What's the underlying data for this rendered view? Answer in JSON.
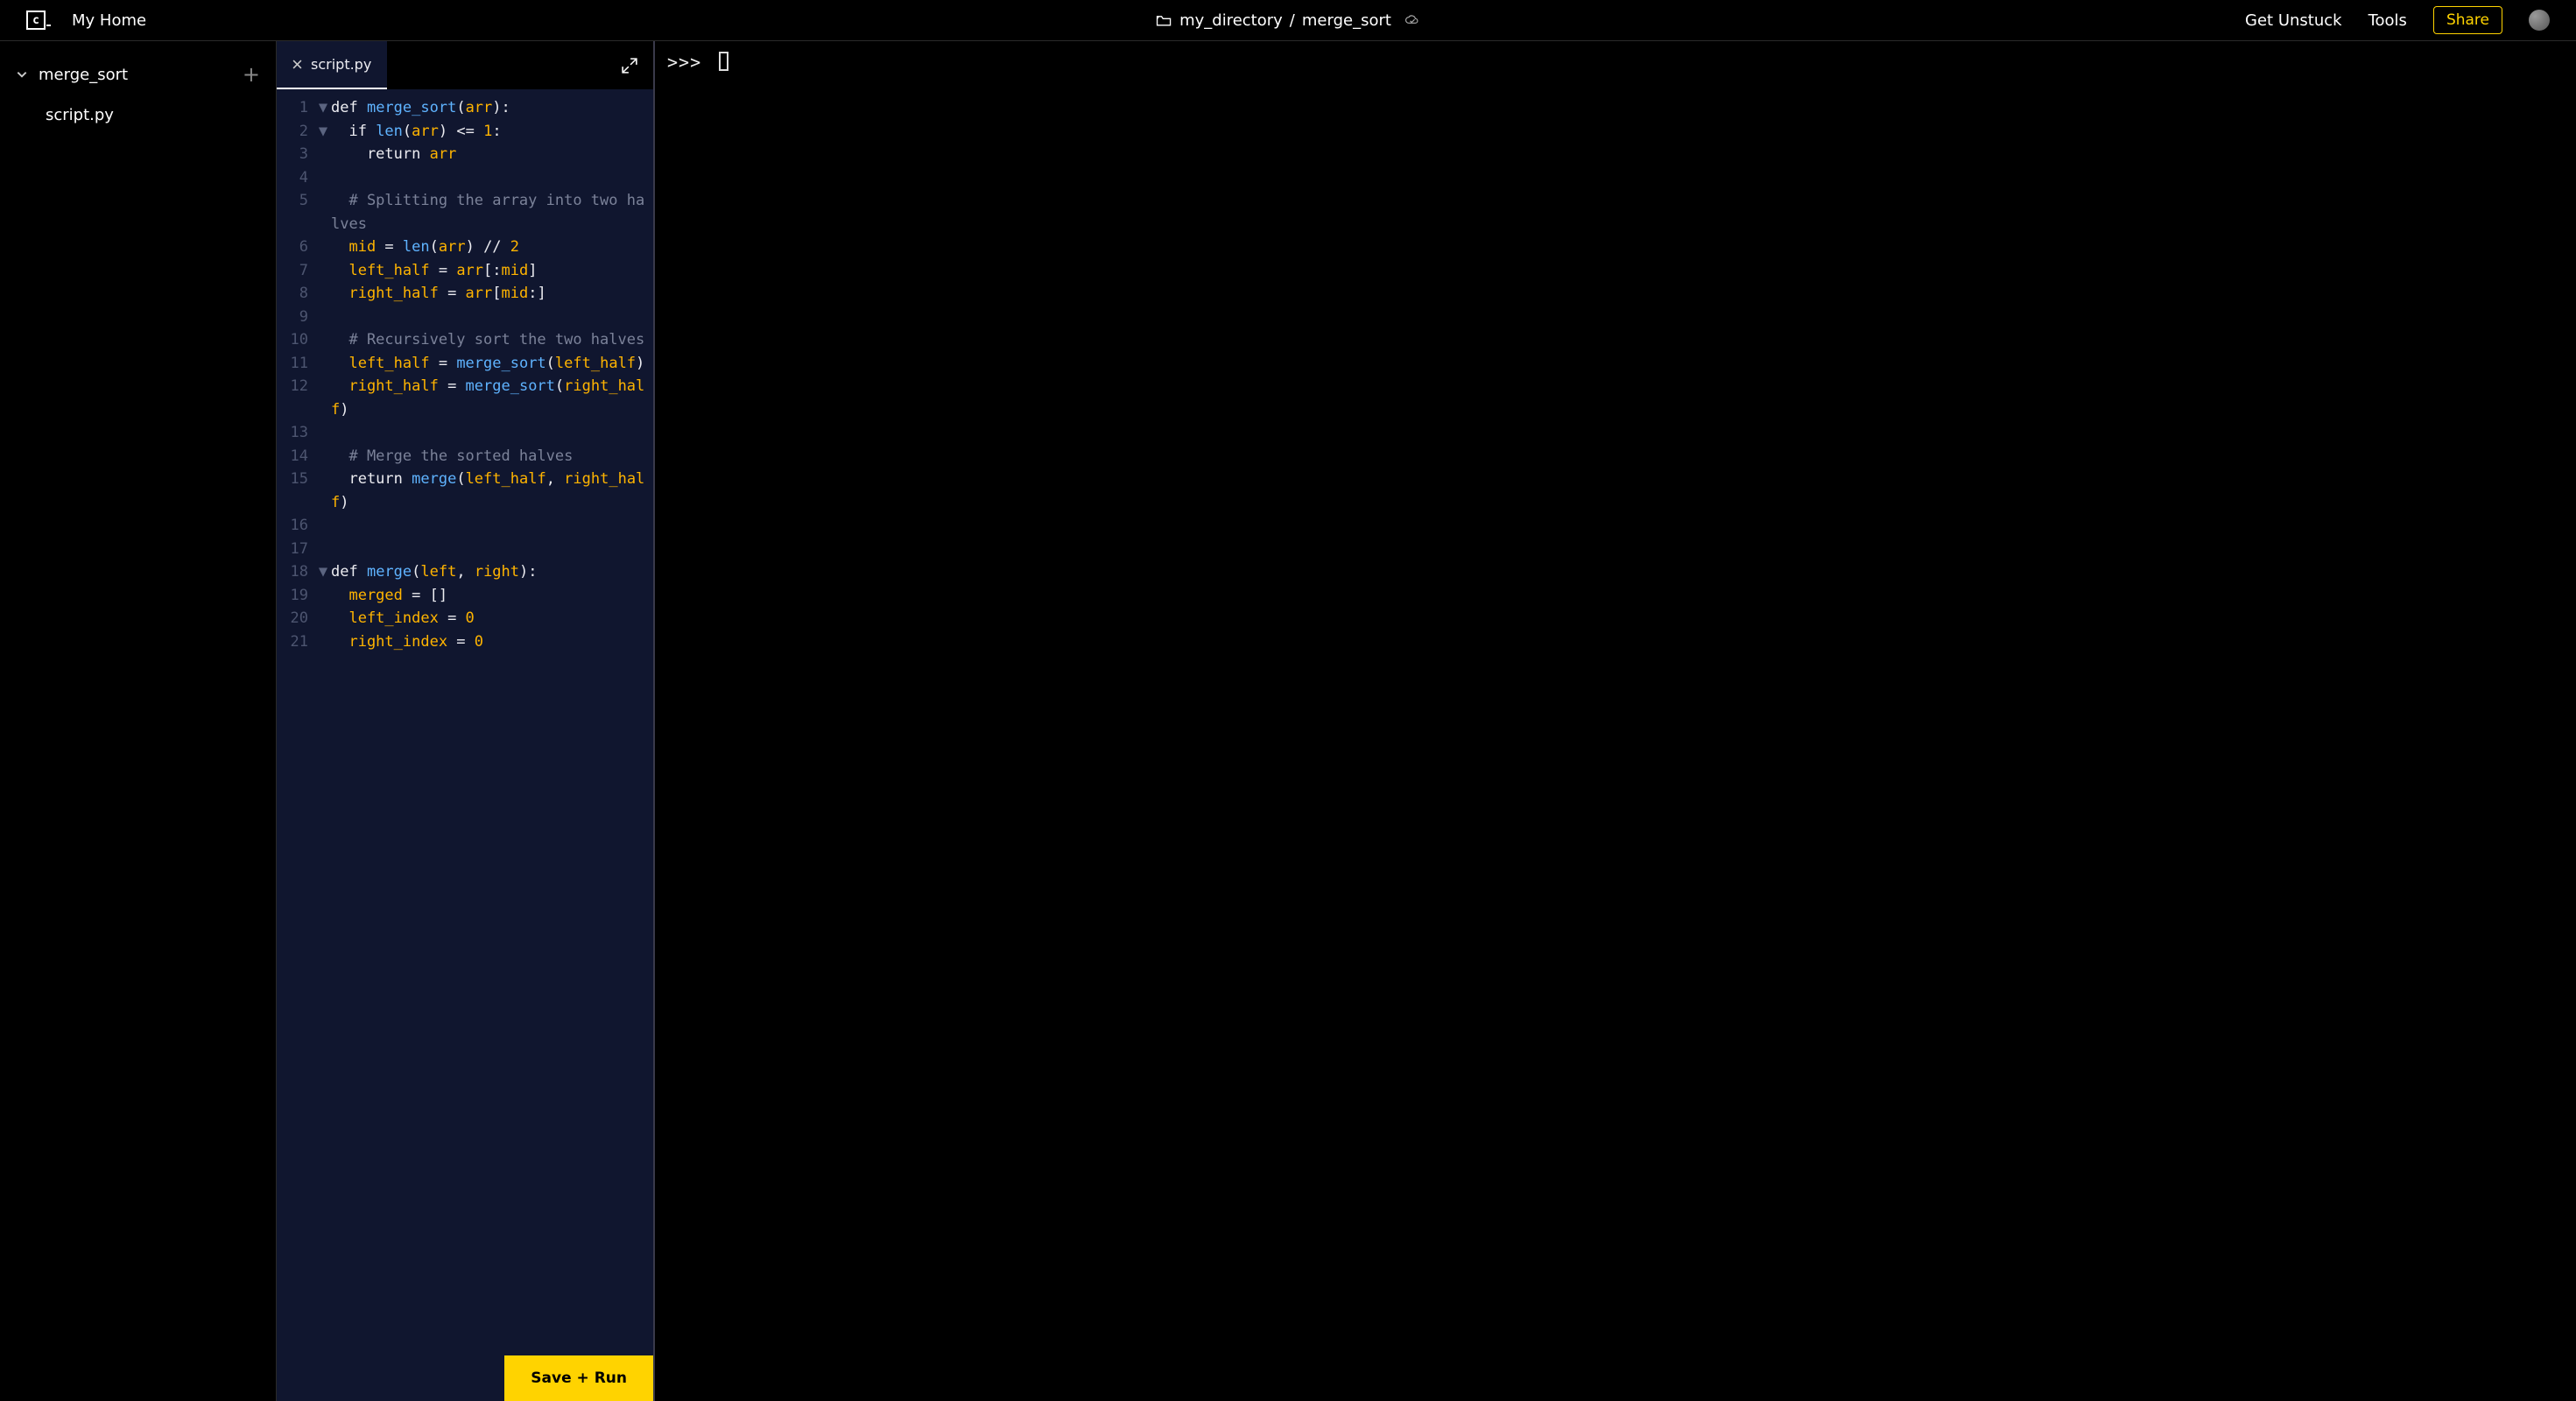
{
  "header": {
    "home": "My Home",
    "breadcrumb": {
      "dir": "my_directory",
      "proj": "merge_sort"
    },
    "getUnstuck": "Get Unstuck",
    "tools": "Tools",
    "share": "Share"
  },
  "sidebar": {
    "root": "merge_sort",
    "files": [
      "script.py"
    ]
  },
  "editor": {
    "tab": "script.py",
    "run": "Save + Run",
    "lines": [
      {
        "n": 1,
        "fold": "▼",
        "tokens": [
          [
            "kw",
            "def "
          ],
          [
            "fn",
            "merge_sort"
          ],
          [
            "pu",
            "("
          ],
          [
            "var",
            "arr"
          ],
          [
            "pu",
            "):"
          ]
        ]
      },
      {
        "n": 2,
        "fold": "▼",
        "tokens": [
          [
            "sp1",
            ""
          ],
          [
            "kw",
            "if "
          ],
          [
            "fn",
            "len"
          ],
          [
            "pu",
            "("
          ],
          [
            "var",
            "arr"
          ],
          [
            "pu",
            ") <= "
          ],
          [
            "num",
            "1"
          ],
          [
            "pu",
            ":"
          ]
        ]
      },
      {
        "n": 3,
        "fold": "",
        "tokens": [
          [
            "sp2",
            ""
          ],
          [
            "kw",
            "return "
          ],
          [
            "var",
            "arr"
          ]
        ]
      },
      {
        "n": 4,
        "fold": "",
        "tokens": []
      },
      {
        "n": 5,
        "fold": "",
        "tokens": [
          [
            "sp1",
            ""
          ],
          [
            "cm",
            "# Splitting the array into two halves"
          ]
        ]
      },
      {
        "n": 6,
        "fold": "",
        "tokens": [
          [
            "sp1",
            ""
          ],
          [
            "var",
            "mid"
          ],
          [
            "pu",
            " = "
          ],
          [
            "fn",
            "len"
          ],
          [
            "pu",
            "("
          ],
          [
            "var",
            "arr"
          ],
          [
            "pu",
            ") // "
          ],
          [
            "num",
            "2"
          ]
        ]
      },
      {
        "n": 7,
        "fold": "",
        "tokens": [
          [
            "sp1",
            ""
          ],
          [
            "var",
            "left_half"
          ],
          [
            "pu",
            " = "
          ],
          [
            "var",
            "arr"
          ],
          [
            "pu",
            "[:"
          ],
          [
            "var",
            "mid"
          ],
          [
            "pu",
            "]"
          ]
        ]
      },
      {
        "n": 8,
        "fold": "",
        "tokens": [
          [
            "sp1",
            ""
          ],
          [
            "var",
            "right_half"
          ],
          [
            "pu",
            " = "
          ],
          [
            "var",
            "arr"
          ],
          [
            "pu",
            "["
          ],
          [
            "var",
            "mid"
          ],
          [
            "pu",
            ":]"
          ]
        ]
      },
      {
        "n": 9,
        "fold": "",
        "tokens": []
      },
      {
        "n": 10,
        "fold": "",
        "tokens": [
          [
            "sp1",
            ""
          ],
          [
            "cm",
            "# Recursively sort the two halves"
          ]
        ]
      },
      {
        "n": 11,
        "fold": "",
        "tokens": [
          [
            "sp1",
            ""
          ],
          [
            "var",
            "left_half"
          ],
          [
            "pu",
            " = "
          ],
          [
            "fn",
            "merge_sort"
          ],
          [
            "pu",
            "("
          ],
          [
            "var",
            "left_half"
          ],
          [
            "pu",
            ")"
          ]
        ]
      },
      {
        "n": 12,
        "fold": "",
        "tokens": [
          [
            "sp1",
            ""
          ],
          [
            "var",
            "right_half"
          ],
          [
            "pu",
            " = "
          ],
          [
            "fn",
            "merge_sort"
          ],
          [
            "pu",
            "("
          ],
          [
            "var",
            "right_half"
          ],
          [
            "pu",
            ")"
          ]
        ]
      },
      {
        "n": 13,
        "fold": "",
        "tokens": []
      },
      {
        "n": 14,
        "fold": "",
        "tokens": [
          [
            "sp1",
            ""
          ],
          [
            "cm",
            "# Merge the sorted halves"
          ]
        ]
      },
      {
        "n": 15,
        "fold": "",
        "tokens": [
          [
            "sp1",
            ""
          ],
          [
            "kw",
            "return "
          ],
          [
            "fn",
            "merge"
          ],
          [
            "pu",
            "("
          ],
          [
            "var",
            "left_half"
          ],
          [
            "pu",
            ", "
          ],
          [
            "var",
            "right_half"
          ],
          [
            "pu",
            ")"
          ]
        ]
      },
      {
        "n": 16,
        "fold": "",
        "tokens": []
      },
      {
        "n": 17,
        "fold": "",
        "tokens": []
      },
      {
        "n": 18,
        "fold": "▼",
        "tokens": [
          [
            "kw",
            "def "
          ],
          [
            "fn",
            "merge"
          ],
          [
            "pu",
            "("
          ],
          [
            "var",
            "left"
          ],
          [
            "pu",
            ", "
          ],
          [
            "var",
            "right"
          ],
          [
            "pu",
            "):"
          ]
        ]
      },
      {
        "n": 19,
        "fold": "",
        "tokens": [
          [
            "sp1",
            ""
          ],
          [
            "var",
            "merged"
          ],
          [
            "pu",
            " = []"
          ]
        ]
      },
      {
        "n": 20,
        "fold": "",
        "tokens": [
          [
            "sp1",
            ""
          ],
          [
            "var",
            "left_index"
          ],
          [
            "pu",
            " = "
          ],
          [
            "num",
            "0"
          ]
        ]
      },
      {
        "n": 21,
        "fold": "",
        "tokens": [
          [
            "sp1",
            ""
          ],
          [
            "var",
            "right_index"
          ],
          [
            "pu",
            " = "
          ],
          [
            "num",
            "0"
          ]
        ]
      }
    ]
  },
  "terminal": {
    "prompt": ">>>"
  }
}
